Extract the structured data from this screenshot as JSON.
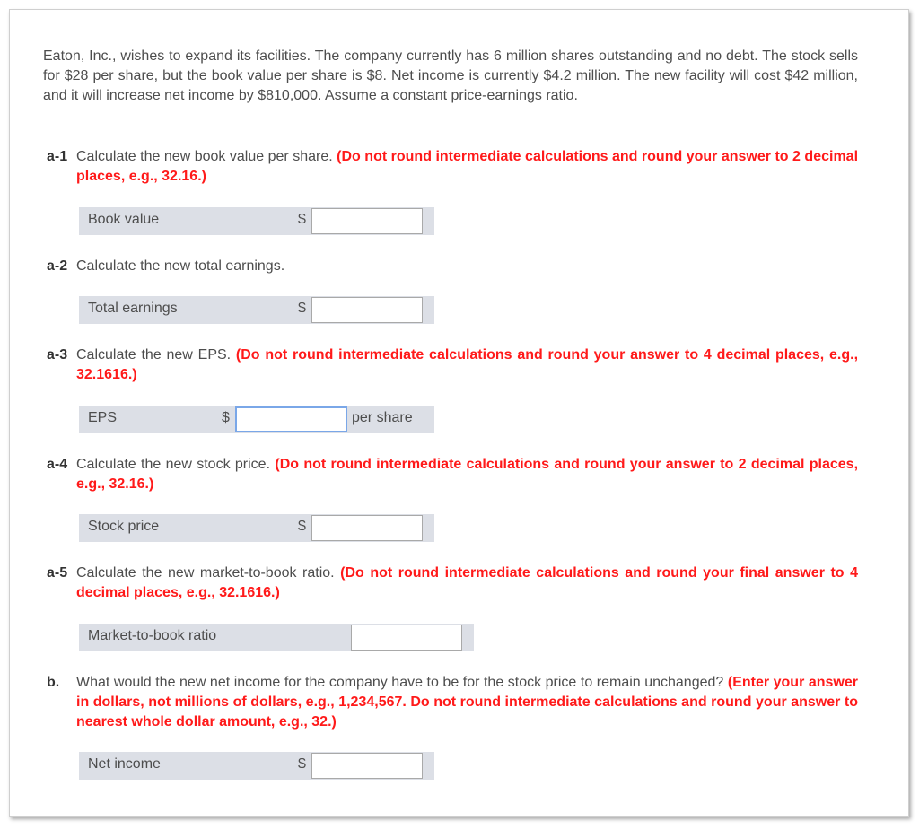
{
  "intro": "Eaton, Inc., wishes to expand its facilities. The company currently has 6 million shares outstanding and no debt. The stock sells for $28 per share, but the book value per share is $8. Net income is currently $4.2 million. The new facility will cost $42 million, and it will increase net income by $810,000. Assume a constant price-earnings ratio.",
  "questions": [
    {
      "num": "a-1",
      "text": "Calculate the new book value per share.",
      "instruction": "(Do not round intermediate calculations and round your answer to 2 decimal places, e.g., 32.16.)",
      "field": {
        "label": "Book value",
        "prefix": "$",
        "value": "",
        "suffix": ""
      }
    },
    {
      "num": "a-2",
      "text": "Calculate the new total earnings.",
      "instruction": "",
      "field": {
        "label": "Total earnings",
        "prefix": "$",
        "value": "",
        "suffix": ""
      }
    },
    {
      "num": "a-3",
      "text": "Calculate the new EPS.",
      "instruction": "(Do not round intermediate calculations and round your answer to 4 decimal places, e.g., 32.1616.)",
      "field": {
        "label": "EPS",
        "prefix": "$",
        "value": "",
        "suffix": "per share"
      }
    },
    {
      "num": "a-4",
      "text": "Calculate the new stock price.",
      "instruction": "(Do not round intermediate calculations and round your answer to 2 decimal places, e.g., 32.16.)",
      "field": {
        "label": "Stock price",
        "prefix": "$",
        "value": "",
        "suffix": ""
      }
    },
    {
      "num": "a-5",
      "text": "Calculate the new market-to-book ratio.",
      "instruction": "(Do not round intermediate calculations and round your final answer to 4 decimal places, e.g., 32.1616.)",
      "field": {
        "label": "Market-to-book ratio",
        "prefix": "",
        "value": "",
        "suffix": ""
      }
    },
    {
      "num": "b.",
      "text": "What would the new net income for the company have to be for the stock price to remain unchanged?",
      "instruction": "(Enter your answer in dollars, not millions of dollars, e.g., 1,234,567. Do not round intermediate calculations and round your answer to nearest whole dollar amount, e.g., 32.)",
      "field": {
        "label": "Net income",
        "prefix": "$",
        "value": "",
        "suffix": ""
      }
    }
  ],
  "colors": {
    "instruction_red": "#ff1a1a",
    "row_bg": "#dcdfe6",
    "focus_border": "#7aa7e8"
  }
}
